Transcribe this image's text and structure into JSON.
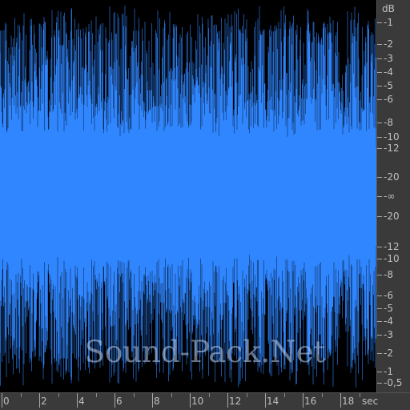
{
  "waveform": {
    "color": "#2f86ff",
    "background": "#000000",
    "duration_sec": 19.5
  },
  "db_scale": {
    "unit_label": "dB",
    "top_labels": [
      "-1",
      "-2",
      "-3",
      "-4",
      "-5",
      "-6",
      "-8",
      "-10",
      "-12",
      "-20"
    ],
    "center_label": "-∞",
    "bottom_labels": [
      "-20",
      "-12",
      "-10",
      "-8",
      "-6",
      "-5",
      "-4",
      "-3",
      "-2",
      "-1",
      "-0,5"
    ]
  },
  "time_scale": {
    "labels": [
      "0",
      "2",
      "4",
      "6",
      "8",
      "10",
      "12",
      "14",
      "16",
      "18"
    ],
    "unit_label": "sec"
  },
  "watermark": "Sound-Pack.Net",
  "colors": {
    "ruler_bg": "#3a3a3a",
    "ruler_text": "#c0c0c0"
  }
}
